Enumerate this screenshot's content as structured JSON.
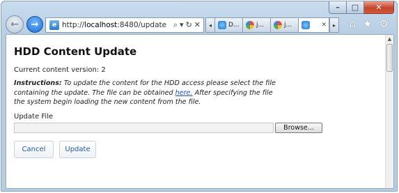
{
  "browser": {
    "address": {
      "prefix": "http://",
      "host": "localhost",
      "rest": ":8480/update"
    },
    "tabs": [
      {
        "label": "D...",
        "icon": "ie-icon"
      },
      {
        "label": "j...",
        "icon": "multicolor-icon"
      },
      {
        "label": "j...",
        "icon": "multicolor-icon"
      },
      {
        "label": "",
        "icon": "ie-icon",
        "active": true
      }
    ],
    "window_buttons": {
      "minimize": "–",
      "maximize": "□",
      "close": "✕"
    }
  },
  "page": {
    "title": "HDD Content Update",
    "version_text": "Current content version: 2",
    "instructions": {
      "label": "Instructions:",
      "text_before_link": " To update the content for the HDD access please select the file containing the update. The file can be obtained ",
      "link": "here.",
      "text_after_link": " After specifying the file the system begin loading the new content from the file."
    },
    "file_label": "Update File",
    "file_value": "",
    "browse_label": "Browse...",
    "cancel_label": "Cancel",
    "update_label": "Update"
  }
}
